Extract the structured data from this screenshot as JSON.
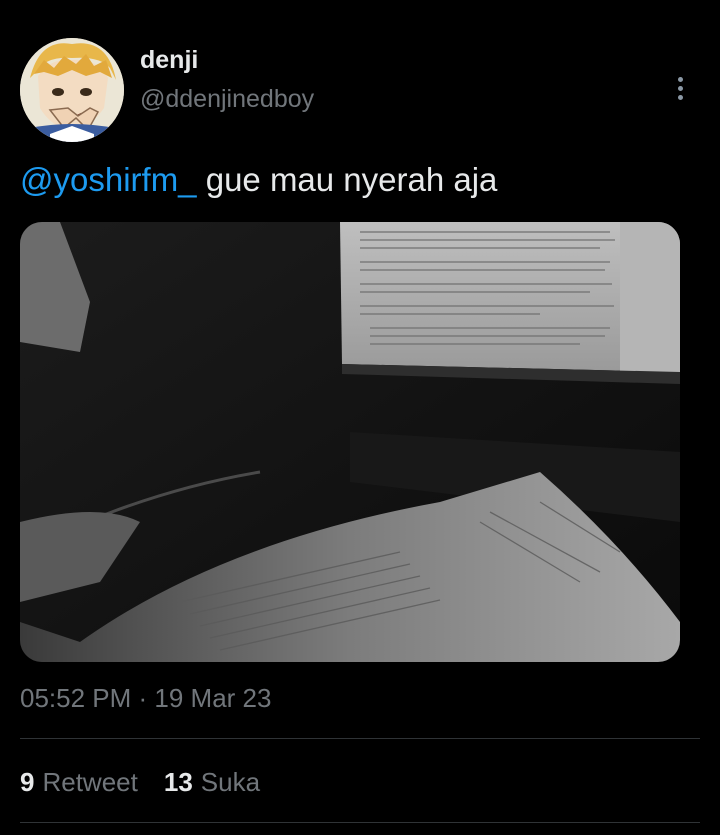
{
  "author": {
    "display_name": "denji",
    "handle": "@ddenjinedboy",
    "avatar_icon": "avatar-anime-character"
  },
  "tweet": {
    "mention": "@yoshirfm_",
    "text": " gue mau nyerah aja",
    "timestamp": "05:52 PM · 19 Mar 23"
  },
  "stats": {
    "retweet_count": "9",
    "retweet_label": "Retweet",
    "like_count": "13",
    "like_label": "Suka"
  },
  "colors": {
    "link": "#1d9bf0",
    "muted": "#71767b",
    "text": "#e7e9ea",
    "background": "#000000"
  }
}
